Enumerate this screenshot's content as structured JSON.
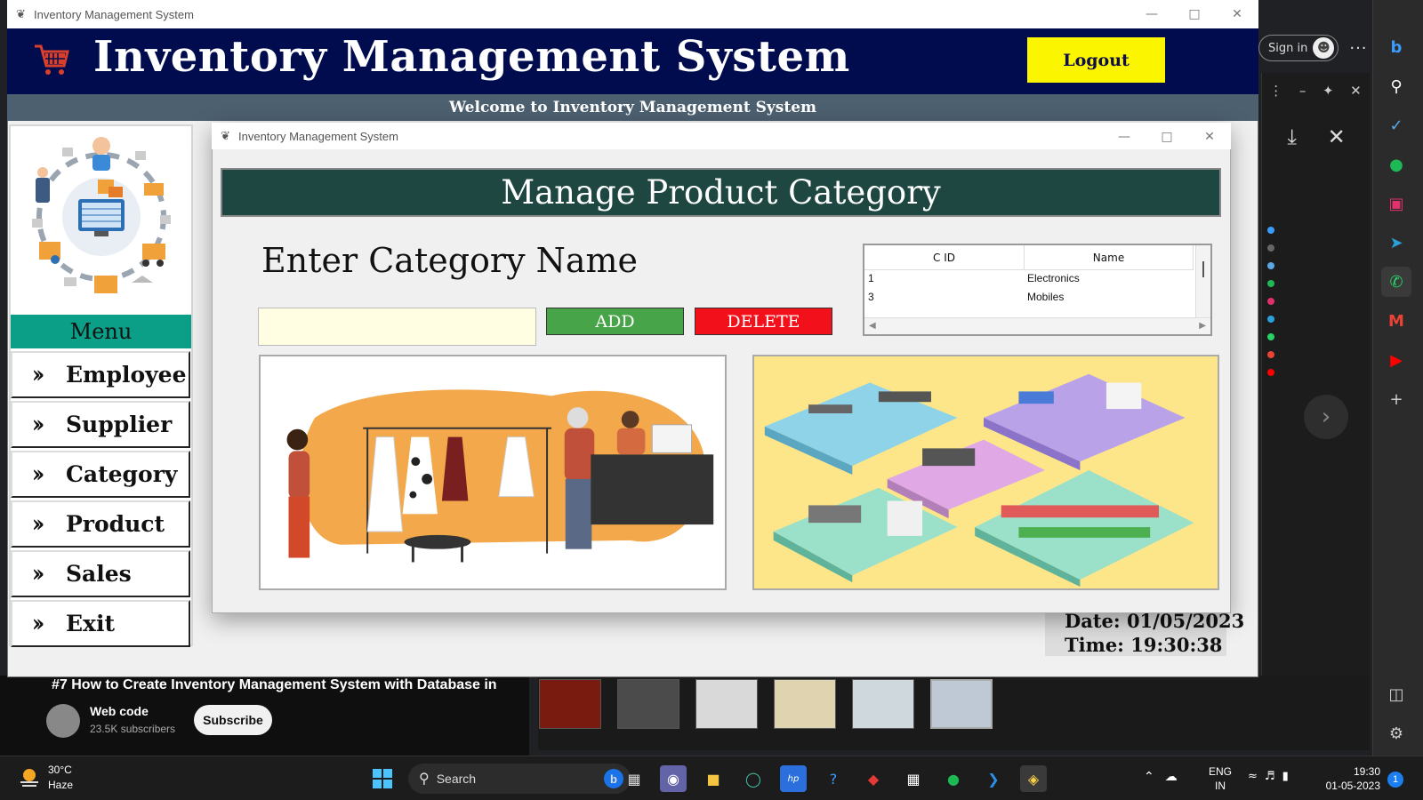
{
  "app": {
    "window_title": "Inventory Management System",
    "title": "Inventory Management System",
    "logout_label": "Logout",
    "welcome": "Welcome to Inventory Management System"
  },
  "menu": {
    "header": "Menu",
    "items": [
      {
        "label": "Employee"
      },
      {
        "label": "Supplier"
      },
      {
        "label": "Category"
      },
      {
        "label": "Product"
      },
      {
        "label": "Sales"
      },
      {
        "label": "Exit"
      }
    ]
  },
  "datetime": {
    "date": "Date: 01/05/2023",
    "time": "Time: 19:30:38"
  },
  "child": {
    "window_title": "Inventory Management System",
    "heading": "Manage Product Category",
    "enter_label": "Enter Category Name",
    "input_value": "",
    "add_label": "ADD",
    "delete_label": "DELETE",
    "table": {
      "columns": [
        "C ID",
        "Name"
      ],
      "rows": [
        {
          "cid": "1",
          "name": "Electronics"
        },
        {
          "cid": "3",
          "name": "Mobiles"
        }
      ]
    }
  },
  "browser": {
    "signin_label": "Sign in"
  },
  "video": {
    "title": "#7 How to Create Inventory Management System with Database in",
    "channel": "Web code",
    "subscribers": "23.5K subscribers",
    "subscribe_label": "Subscribe"
  },
  "taskbar": {
    "temperature": "30°C",
    "weather": "Haze",
    "search_label": "Search",
    "lang_line1": "ENG",
    "lang_line2": "IN",
    "time": "19:30",
    "date": "01-05-2023",
    "notification_count": "1"
  },
  "colors": {
    "header_bg": "#010c4f",
    "logout_bg": "#fcf500",
    "menu_header_bg": "#0b9f88",
    "heading_bg": "#1d4740",
    "add_bg": "#48a448",
    "delete_bg": "#f2111a",
    "input_bg": "#fffee3"
  }
}
